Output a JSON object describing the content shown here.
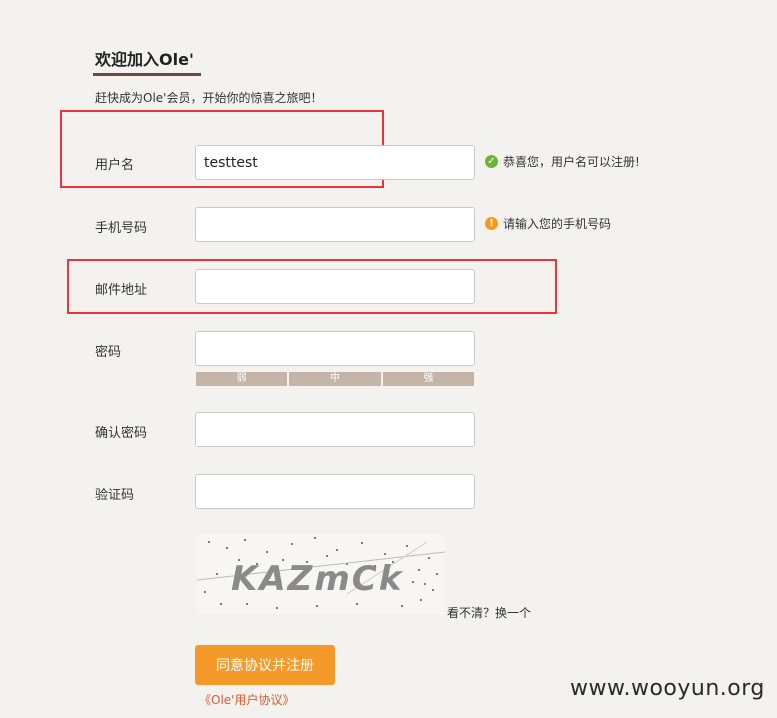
{
  "header": {
    "title": "欢迎加入Ole'",
    "subtitle": "赶快成为Ole'会员，开始你的惊喜之旅吧！"
  },
  "form": {
    "username": {
      "label": "用户名",
      "value": "testtest",
      "hint": "恭喜您，用户名可以注册!"
    },
    "phone": {
      "label": "手机号码",
      "value": "",
      "hint": "请输入您的手机号码"
    },
    "email": {
      "label": "邮件地址",
      "value": ""
    },
    "password": {
      "label": "密码",
      "value": "",
      "strength_labels": [
        "弱",
        "中",
        "强"
      ]
    },
    "confirm_password": {
      "label": "确认密码",
      "value": ""
    },
    "captcha": {
      "label": "验证码",
      "value": "",
      "image_text": "KAZmCk",
      "refresh_text": "看不清？换一个"
    }
  },
  "actions": {
    "submit_label": "同意协议并注册",
    "agreement_link": "《Ole'用户协议》"
  },
  "watermark": "www.wooyun.org",
  "colors": {
    "accent": "#f5992a",
    "highlight_border": "#e8343a",
    "ok_icon": "#6bb33a",
    "warn_icon": "#f39a1e",
    "link": "#e0582f"
  },
  "icons": {
    "ok": "check-circle-icon",
    "warn": "exclamation-circle-icon"
  }
}
